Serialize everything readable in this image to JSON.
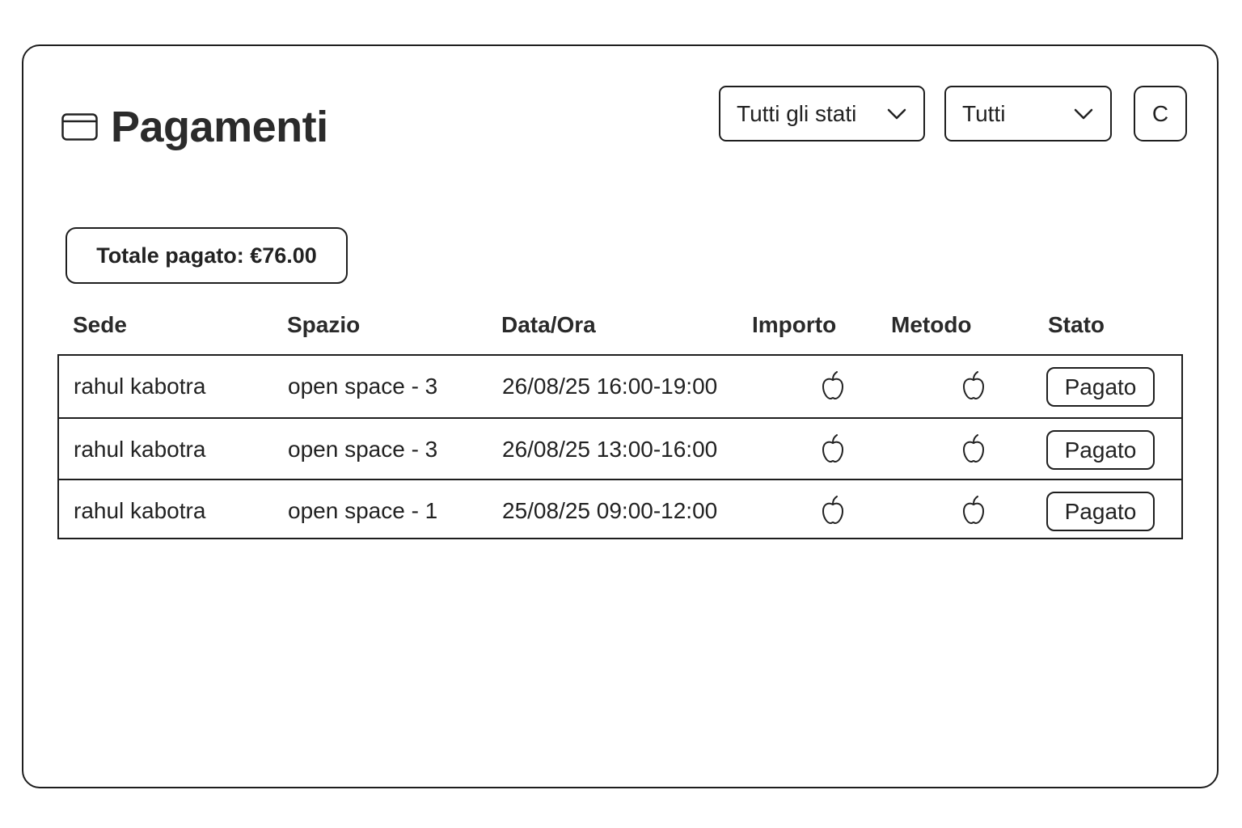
{
  "header": {
    "title": "Pagamenti",
    "icon": "credit-card-icon"
  },
  "filters": {
    "status": {
      "selected": "Tutti gli stati",
      "icon": "chevron-down-icon"
    },
    "period": {
      "selected": "Tutti",
      "icon": "chevron-down-icon"
    },
    "action_button_label": "C"
  },
  "summary": {
    "total_label": "Totale pagato: €76.00"
  },
  "table": {
    "columns": [
      "Sede",
      "Spazio",
      "Data/Ora",
      "Importo",
      "Metodo",
      "Stato"
    ],
    "rows": [
      {
        "sede": "rahul kabotra",
        "spazio": "open space - 3",
        "data_ora": "26/08/25 16:00-19:00",
        "importo_icon": "apple-icon",
        "metodo_icon": "apple-icon",
        "stato": "Pagato"
      },
      {
        "sede": "rahul kabotra",
        "spazio": "open space - 3",
        "data_ora": "26/08/25 13:00-16:00",
        "importo_icon": "apple-icon",
        "metodo_icon": "apple-icon",
        "stato": "Pagato"
      },
      {
        "sede": "rahul kabotra",
        "spazio": "open space - 1",
        "data_ora": "25/08/25 09:00-12:00",
        "importo_icon": "apple-icon",
        "metodo_icon": "apple-icon",
        "stato": "Pagato"
      }
    ]
  },
  "colors": {
    "border": "#1e1e1e",
    "text": "#222222",
    "background": "#ffffff"
  }
}
